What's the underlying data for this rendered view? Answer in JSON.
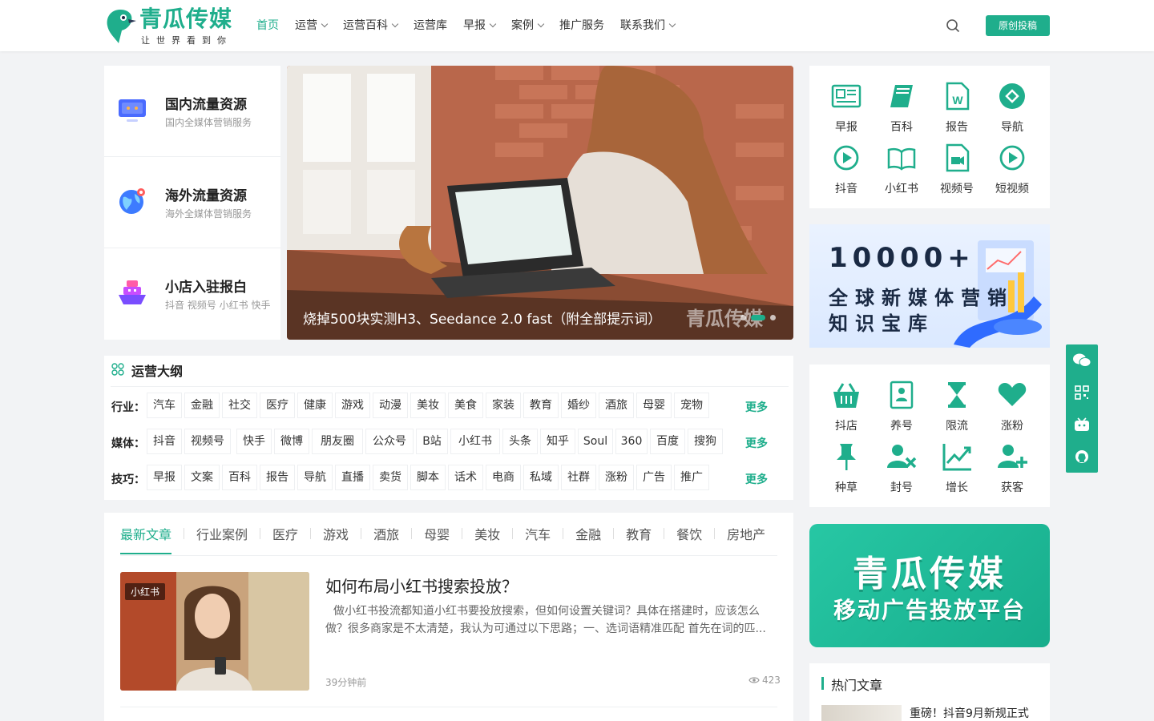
{
  "header": {
    "logo_title": "青瓜传媒",
    "logo_tagline": "让世界看到你",
    "nav": [
      {
        "label": "首页",
        "active": true,
        "dropdown": false
      },
      {
        "label": "运营",
        "dropdown": true
      },
      {
        "label": "运营百科",
        "dropdown": true
      },
      {
        "label": "运营库",
        "dropdown": false
      },
      {
        "label": "早报",
        "dropdown": true
      },
      {
        "label": "案例",
        "dropdown": true
      },
      {
        "label": "推广服务",
        "dropdown": false
      },
      {
        "label": "联系我们",
        "dropdown": true
      }
    ],
    "search_icon": "search-icon",
    "submit_label": "原创投稿"
  },
  "resources": [
    {
      "title": "国内流量资源",
      "sub": "国内全媒体营销服务",
      "icon": "monitor-icon"
    },
    {
      "title": "海外流量资源",
      "sub": "海外全媒体营销服务",
      "icon": "globe-icon"
    },
    {
      "title": "小店入驻报白",
      "sub": "抖音 视频号 小红书 快手",
      "icon": "ship-icon"
    }
  ],
  "hero": {
    "caption": "烧掉500块实测H3、Seedance 2.0 fast（附全部提示词）",
    "watermark": "青瓜传媒",
    "slides": 4,
    "active_slide": 2
  },
  "quick_grid_1": [
    {
      "label": "早报",
      "icon": "newspaper-icon"
    },
    {
      "label": "百科",
      "icon": "book-icon"
    },
    {
      "label": "报告",
      "icon": "word-doc-icon"
    },
    {
      "label": "导航",
      "icon": "compass-icon"
    },
    {
      "label": "抖音",
      "icon": "play-circle-icon"
    },
    {
      "label": "小红书",
      "icon": "open-book-icon"
    },
    {
      "label": "视频号",
      "icon": "video-file-icon"
    },
    {
      "label": "短视频",
      "icon": "play-circle-icon"
    }
  ],
  "knowledge_banner": {
    "number": "10000+",
    "line1": "全球新媒体营销",
    "line2": "知识宝库"
  },
  "quick_grid_2": [
    {
      "label": "抖店",
      "icon": "basket-icon"
    },
    {
      "label": "养号",
      "icon": "contact-card-icon"
    },
    {
      "label": "限流",
      "icon": "hourglass-icon"
    },
    {
      "label": "涨粉",
      "icon": "heart-icon"
    },
    {
      "label": "种草",
      "icon": "pin-icon"
    },
    {
      "label": "封号",
      "icon": "user-block-icon"
    },
    {
      "label": "增长",
      "icon": "chart-line-icon"
    },
    {
      "label": "获客",
      "icon": "user-plus-icon"
    }
  ],
  "side_toolbar": [
    "wechat-icon",
    "qrcode-icon",
    "bilibili-icon",
    "github-icon"
  ],
  "outline": {
    "title": "运营大纲",
    "more": "更多",
    "rows": [
      {
        "label": "行业：",
        "tags": [
          "汽车",
          "金融",
          "社交",
          "医疗",
          "健康",
          "游戏",
          "动漫",
          "美妆",
          "美食",
          "家装",
          "教育",
          "婚纱",
          "酒旅",
          "母婴",
          "宠物"
        ]
      },
      {
        "label": "媒体：",
        "tags": [
          "抖音",
          "视频号",
          "快手",
          "微博",
          "朋友圈",
          "公众号",
          "B站",
          "小红书",
          "头条",
          "知乎",
          "Soul",
          "360",
          "百度",
          "搜狗"
        ]
      },
      {
        "label": "技巧：",
        "tags": [
          "早报",
          "文案",
          "百科",
          "报告",
          "导航",
          "直播",
          "卖货",
          "脚本",
          "话术",
          "电商",
          "私域",
          "社群",
          "涨粉",
          "广告",
          "推广"
        ]
      }
    ]
  },
  "tabs": [
    "最新文章",
    "行业案例",
    "医疗",
    "游戏",
    "酒旅",
    "母婴",
    "美妆",
    "汽车",
    "金融",
    "教育",
    "餐饮",
    "房地产"
  ],
  "article": {
    "badge": "小红书",
    "title": "如何布局小红书搜索投放？",
    "excerpt": "做小红书投流都知道小红书要投放搜索，但如何设置关键词？具体在搭建时，应该怎么做？很多商家是不太清楚，我认为可通过以下思路；一、选词语精准匹配 首先在词的匹...",
    "time": "39分钟前",
    "views": "423"
  },
  "promo": {
    "line1": "青瓜传媒",
    "line2": "移动广告投放平台"
  },
  "hot": {
    "title": "热门文章",
    "first_item": "重磅！抖音9月新规正式"
  },
  "colors": {
    "brand": "#1fae8c",
    "background": "#f2f3f5"
  }
}
